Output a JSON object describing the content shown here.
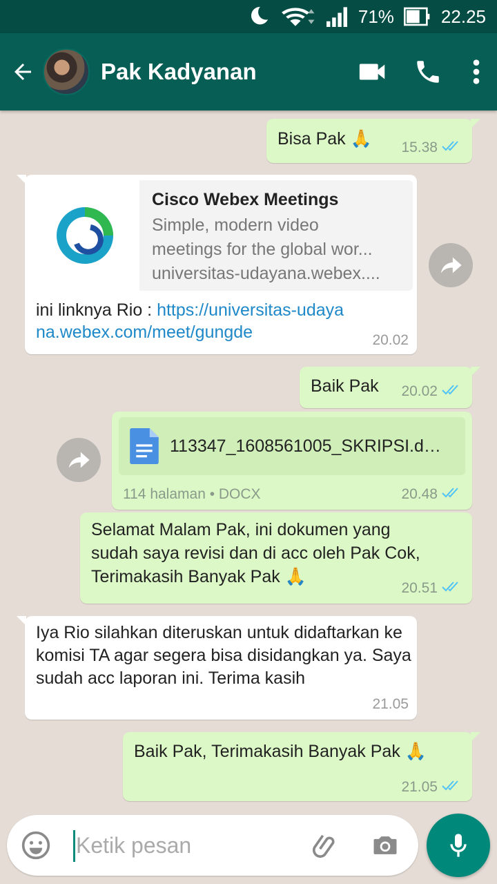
{
  "status": {
    "battery": "71%",
    "time": "22.25"
  },
  "header": {
    "name": "Pak Kadyanan"
  },
  "messages": {
    "m1": {
      "text": "Bisa Pak 🙏",
      "time": "15.38"
    },
    "m2": {
      "preview_title": "Cisco Webex Meetings",
      "preview_desc_1": "Simple, modern video",
      "preview_desc_2": "meetings for the global wor...",
      "preview_domain": "universitas-udayana.webex....",
      "text": "ini linknya Rio : ",
      "link": "https://universitas-udayana.webex.com/meet/gungde",
      "time": "20.02"
    },
    "m3": {
      "text": "Baik Pak",
      "time": "20.02"
    },
    "m4": {
      "file_name": "113347_1608561005_SKRIPSI.docx",
      "meta": "114 halaman • DOCX",
      "time": "20.48"
    },
    "m5": {
      "text": "Selamat Malam Pak, ini dokumen yang sudah saya revisi dan di acc oleh Pak Cok, Terimakasih Banyak Pak 🙏",
      "time": "20.51"
    },
    "m6": {
      "text": "Iya Rio silahkan diteruskan untuk didaftarkan ke komisi TA agar segera bisa disidangkan ya. Saya sudah acc laporan ini. Terima kasih",
      "time": "21.05"
    },
    "m7": {
      "text": "Baik Pak, Terimakasih Banyak Pak 🙏",
      "time": "21.05"
    }
  },
  "input": {
    "placeholder": "Ketik pesan"
  },
  "colors": {
    "header": "#075e54",
    "status_bar": "#054d44",
    "outgoing": "#dcf8c6",
    "incoming": "#ffffff",
    "fab": "#00897b",
    "read_ticks": "#4fc3f7"
  }
}
